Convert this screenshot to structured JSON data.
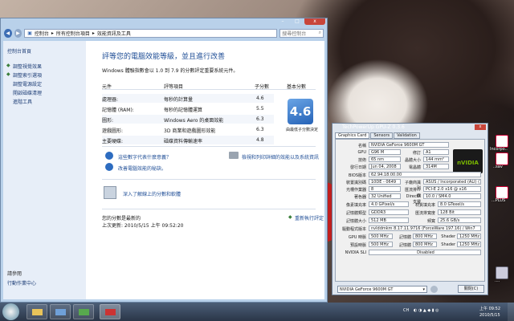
{
  "explorer": {
    "address_parts": [
      "控制台",
      "所有控制台項目",
      "效能資訊及工具"
    ],
    "search_placeholder": "搜尋控制台",
    "window_buttons": {
      "minimize": "–",
      "maximize": "□",
      "close": "x"
    },
    "sidebar": {
      "home": "控制台首頁",
      "links": [
        "調整視覺效果",
        "調整索引選項",
        "調整電源設定",
        "開啟磁碟清理",
        "進階工具"
      ],
      "see_also_title": "請參閱",
      "see_also": [
        "行動作業中心"
      ]
    },
    "heading": "評等您的電腦效能等級，並且進行改善",
    "description": "Windows 體驗指數會以 1.0 到 7.9 的分數評定重要系統元件。",
    "table": {
      "headers": [
        "元件",
        "評等項目",
        "子分數",
        "基本分數"
      ],
      "rows": [
        {
          "component": "處理器:",
          "rating": "每秒的計算量",
          "score": "4.6"
        },
        {
          "component": "記憶體 (RAM):",
          "rating": "每秒的記憶體運算",
          "score": "5.5"
        },
        {
          "component": "圖形:",
          "rating": "Windows Aero 的桌面效能",
          "score": "6.3"
        },
        {
          "component": "遊戲圖形:",
          "rating": "3D 商業和遊戲圖形效能",
          "score": "6.3"
        },
        {
          "component": "主要硬碟:",
          "rating": "磁碟資料傳輸速率",
          "score": "4.8"
        }
      ],
      "base_score": "4.6",
      "base_caption": "由最低子分數決定"
    },
    "links": {
      "what_mean": "這些數字代表什麼意義？",
      "improve": "改善電腦效能的秘訣。",
      "print": "檢視和列印詳細的效能以及系統資訊",
      "online": "深入了解線上的分數和軟體"
    },
    "footer": {
      "last_rated_line1": "您的分數是最新的",
      "last_rated_line2": "上次更新: 2010/5/15 上午 09:52:20",
      "rerun": "重新執行評定"
    }
  },
  "gpuz": {
    "title": "TechPowerUp GPU-Z 0.3.6",
    "close": "x",
    "tabs": [
      "Graphics Card",
      "Sensors",
      "Validation"
    ],
    "logo_text": "nVIDIA",
    "fields": {
      "name_label": "名稱",
      "name": "NVIDIA GeForce 9600M GT",
      "gpu_label": "GPU",
      "gpu": "G96 M",
      "rev_label": "修訂",
      "rev": "A1",
      "tech_label": "技術",
      "tech": "65 nm",
      "die_label": "晶體大小",
      "die": "144 mm²",
      "date_label": "發行日期",
      "date": "Jun 04, 2008",
      "trans_label": "電晶體",
      "trans": "314M",
      "bios_label": "BIOS版本",
      "bios": "62.94.18.00.00",
      "devid_label": "裝置識別碼",
      "devid": "10DE - 0649",
      "subv_label": "子廠商識別",
      "subv": "ASUS / Incorporated (ALI) (1043)",
      "rops_label": "光柵作業器",
      "rops": "8",
      "bus_label": "匯流排介面",
      "bus": "PCI-E 2.0 x16 @ x16",
      "shaders_label": "著色器",
      "shaders": "32 Unified",
      "dx_label": "DirectX 支援",
      "dx": "10.0 / SM4.0",
      "pixel_label": "像素填充率",
      "pixel": "4.0 GPixel/s",
      "texture_label": "材質填充率",
      "texture": "8.0 GTexel/s",
      "memtype_label": "記憶體類型",
      "memtype": "GDDR3",
      "buswidth_label": "匯流排寬度",
      "buswidth": "128 Bit",
      "memsize_label": "記憶體大小",
      "memsize": "512 MB",
      "bandwidth_label": "頻寬",
      "bandwidth": "25.6 GB/s",
      "driver_label": "驅動程式版本",
      "driver": "nvlddmkm 8.17.11.9716 (ForceWare 197.16) / Win7",
      "gpuclock_label": "GPU 時脈",
      "gpuclock": "500 MHz",
      "mem_label": "記憶體",
      "mem": "800 MHz",
      "shader_label": "Shader",
      "shader": "1250 MHz",
      "defclock_label": "預設時脈",
      "defclock": "500 MHz",
      "defmem_label": "記憶體",
      "defmem": "800 MHz",
      "defshader_label": "Shader",
      "defshader": "1250 MHz",
      "sli_label": "NVIDIA SLI",
      "sli": "Disabled"
    },
    "select_value": "NVIDIA GeForce 9600M GT",
    "close_button": "關閉(C)"
  },
  "desktop_icons": [
    {
      "label": "Incorpo.."
    },
    {
      "label": "..sav"
    },
    {
      "label": "...PLUS"
    },
    {
      "label": "...."
    }
  ],
  "taskbar": {
    "lang": "CH",
    "time": "上午 09:52",
    "date": "2010/5/15"
  },
  "colors": {
    "accent": "#1f4e96",
    "score_badge": "#2562b6",
    "nvidia_green": "#7ab800",
    "close_red": "#c8453a"
  }
}
